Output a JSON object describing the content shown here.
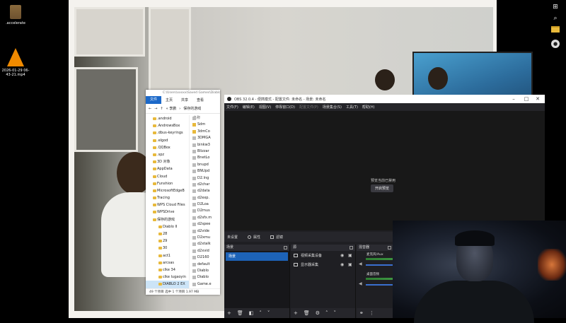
{
  "desktop": {
    "icons": [
      {
        "label": ".accelerate",
        "icon": "folder-icon"
      },
      {
        "label": "2026-01-29 06-43-21.mp4",
        "icon": "vlc-icon"
      }
    ]
  },
  "taskbar_right": {
    "icons": [
      "windows-icon",
      "search-icon",
      "file-explorer-icon",
      "obs-icon"
    ]
  },
  "explorer": {
    "title": "C:\\Users\\xxxxx\\Saved Games\\Diablo II\\DIABLO 2 EXPANSION SET LORD OF DESTRUCTION",
    "ribbon": [
      "文件",
      "主页",
      "共享",
      "查看"
    ],
    "breadcrumb": [
      "« 李鹏",
      "保存的游戏"
    ],
    "column_header": "名称",
    "nav_items": [
      {
        "label": ".android"
      },
      {
        "label": ".AndrowsBox"
      },
      {
        "label": ".dbus-keyrings"
      },
      {
        "label": ".elgod"
      },
      {
        "label": ".QQBox"
      },
      {
        "label": ".spz"
      },
      {
        "label": "3D 对象"
      },
      {
        "label": "AppData"
      },
      {
        "label": "Cloud"
      },
      {
        "label": "Funshion"
      },
      {
        "label": "MicrosoftEdgeB"
      },
      {
        "label": "Tracing"
      },
      {
        "label": "WPS Cloud Files"
      },
      {
        "label": "WPSDrive"
      },
      {
        "label": "保存的游戏"
      },
      {
        "label": "Diablo II",
        "deep": true
      },
      {
        "label": "28",
        "deep": true
      },
      {
        "label": "29",
        "deep": true
      },
      {
        "label": "30",
        "deep": true
      },
      {
        "label": "act1",
        "deep": true
      },
      {
        "label": "arcsas",
        "deep": true
      },
      {
        "label": "clke 34",
        "deep": true
      },
      {
        "label": "clke lugaoyin",
        "deep": true
      },
      {
        "label": "DIABLO 2 EX",
        "deep": true,
        "selected": true
      }
    ],
    "files": [
      {
        "label": "Sdm",
        "folder": true
      },
      {
        "label": "3dmCo",
        "folder": true
      },
      {
        "label": "3DMGA",
        "folder": false
      },
      {
        "label": "binkw3",
        "folder": false
      },
      {
        "label": "Blizzar",
        "folder": false
      },
      {
        "label": "BnetLo",
        "folder": false
      },
      {
        "label": "bnupd",
        "folder": false
      },
      {
        "label": "BNUpd",
        "folder": false
      },
      {
        "label": "D2.lng",
        "folder": false
      },
      {
        "label": "d2char",
        "folder": false
      },
      {
        "label": "d2data",
        "folder": false
      },
      {
        "label": "d2exp.",
        "folder": false
      },
      {
        "label": "D2Loa",
        "folder": false
      },
      {
        "label": "D2mus",
        "folder": false
      },
      {
        "label": "d2sfx.m",
        "folder": false
      },
      {
        "label": "d2spee",
        "folder": false
      },
      {
        "label": "d2vide",
        "folder": false
      },
      {
        "label": "D2xmu",
        "folder": false
      },
      {
        "label": "d2xtalk",
        "folder": false
      },
      {
        "label": "d2xvid",
        "folder": false
      },
      {
        "label": "D2160",
        "folder": false
      },
      {
        "label": "default",
        "folder": false
      },
      {
        "label": "Diablo",
        "folder": false
      },
      {
        "label": "Diablo",
        "folder": false
      },
      {
        "label": "Game.e",
        "folder": false
      }
    ],
    "status": "49 个项目    选中 1 个项目  1.97 MB"
  },
  "obs": {
    "title": "OBS 32.0.4 - 便携模式 - 配置文件: 未命名 - 场景: 未命名",
    "menu": [
      "文件(F)",
      "编辑(E)",
      "视图(V)",
      "停靠窗口(D)",
      "配置文件(P)",
      "场景集合(S)",
      "工具(T)",
      "帮助(H)"
    ],
    "menu_dim": [
      false,
      false,
      false,
      false,
      true,
      false,
      false,
      false
    ],
    "preview_message": "预览当前已禁用",
    "enable_preview": "开启预览",
    "bar": {
      "scene_label": "未设置",
      "properties": "属性",
      "filters": "滤镜"
    },
    "scenes": {
      "header": "场景",
      "items": [
        "场景"
      ]
    },
    "sources": {
      "header": "源",
      "items": [
        {
          "label": "视频采集设备",
          "icon": "camera-icon"
        },
        {
          "label": "显示器采集",
          "icon": "monitor-icon"
        }
      ]
    },
    "mixer": {
      "header": "混音器",
      "channels": [
        {
          "label": "麦克风/Aux",
          "level": 0.62
        },
        {
          "label": "桌面音频",
          "level": 0.55
        }
      ]
    }
  },
  "accent": "#1d63b8"
}
